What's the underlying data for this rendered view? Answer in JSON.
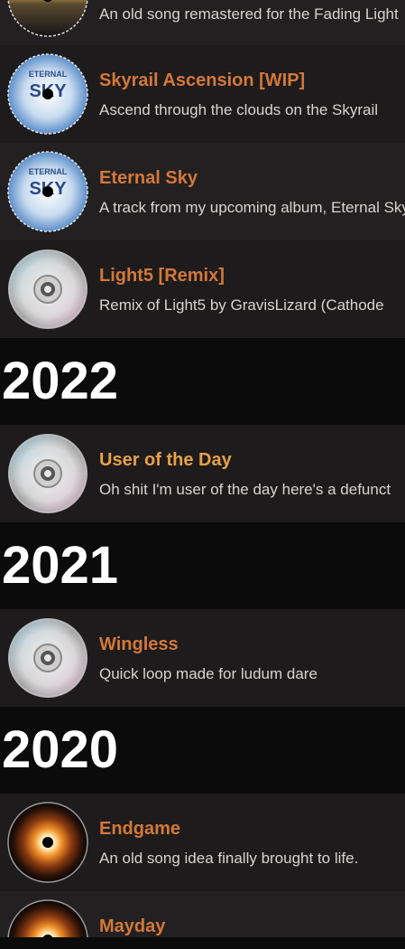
{
  "tracks_top": [
    {
      "title": "",
      "desc": "An old song remastered for the Fading Light",
      "disc": "sunset"
    },
    {
      "title": "Skyrail Ascension [WIP]",
      "desc": "Ascend through the clouds on the Skyrail",
      "disc": "sky"
    },
    {
      "title": "Eternal Sky",
      "desc": "A track from my upcoming album, Eternal Sky",
      "disc": "sky"
    },
    {
      "title": "Light5 [Remix]",
      "desc": "Remix of Light5 by GravisLizard (Cathode",
      "disc": "cd"
    }
  ],
  "years": [
    {
      "year": "2022",
      "tracks": [
        {
          "title": "User of the Day",
          "desc": "Oh shit I'm user of the day here's a defunct",
          "disc": "cd"
        }
      ]
    },
    {
      "year": "2021",
      "tracks": [
        {
          "title": "Wingless",
          "desc": "Quick loop made for ludum dare",
          "disc": "cd"
        }
      ]
    },
    {
      "year": "2020",
      "tracks": [
        {
          "title": "Endgame",
          "desc": "An old song idea finally brought to life.",
          "disc": "eye"
        },
        {
          "title": "Mayday",
          "desc": "",
          "disc": "eye"
        }
      ]
    }
  ],
  "disc_label": {
    "sky_text": "ETERNAL",
    "sky_text2": "SKY"
  },
  "colors": {
    "title": "#d4783a",
    "title_highlight": "#e9a04a",
    "background": "#0c0b0b"
  }
}
